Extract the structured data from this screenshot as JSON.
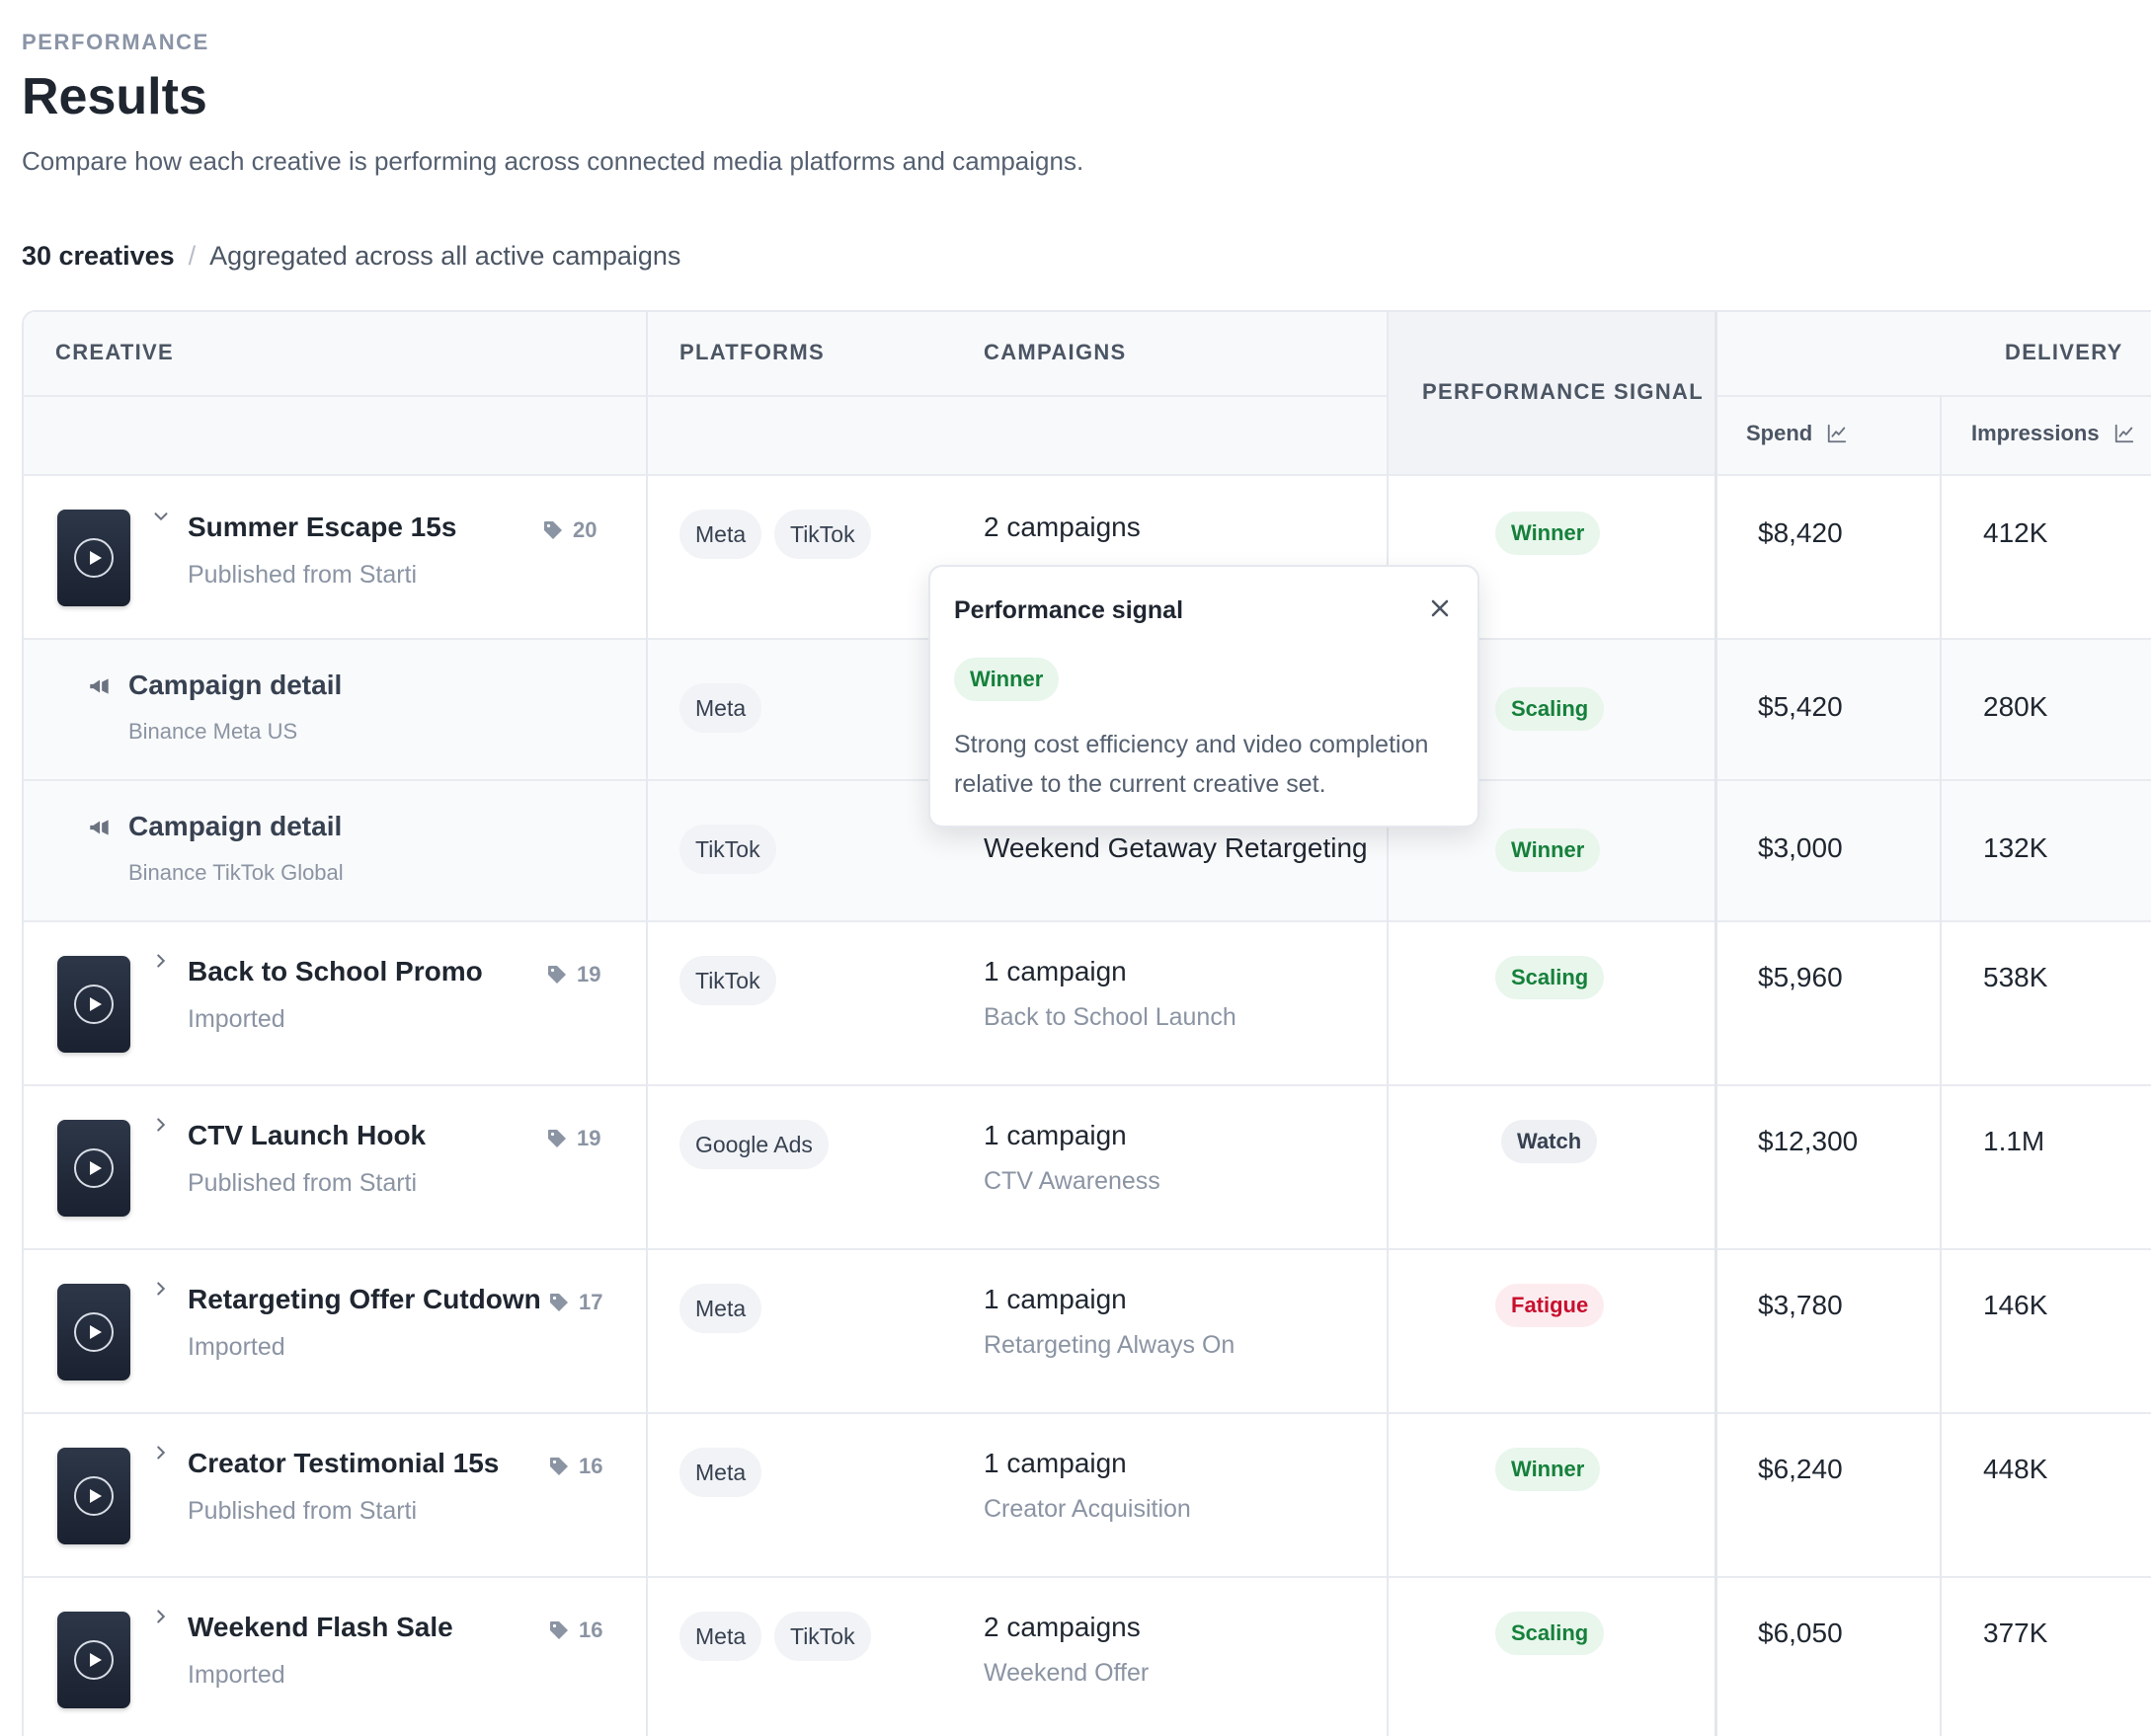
{
  "header": {
    "eyebrow": "PERFORMANCE",
    "title": "Results",
    "subtitle": "Compare how each creative is performing across connected media platforms and campaigns."
  },
  "summary": {
    "count": "30 creatives",
    "separator": "/",
    "description": "Aggregated across all active campaigns"
  },
  "columns": {
    "creative": "CREATIVE",
    "platforms": "PLATFORMS",
    "campaigns": "CAMPAIGNS",
    "signal": "PERFORMANCE SIGNAL",
    "delivery": "DELIVERY",
    "spend": "Spend",
    "impressions": "Impressions"
  },
  "rows": [
    {
      "name": "Summer Escape 15s",
      "source": "Published from Starti",
      "tags": "20",
      "platforms": [
        "Meta",
        "TikTok"
      ],
      "campaigns": "2 campaigns",
      "campaign_detail": "",
      "signal": "Winner",
      "spend": "$8,420",
      "impressions": "412K"
    },
    {
      "name": "Back to School Promo",
      "source": "Imported",
      "tags": "19",
      "platforms": [
        "TikTok"
      ],
      "campaigns": "1 campaign",
      "campaign_detail": "Back to School Launch",
      "signal": "Scaling",
      "spend": "$5,960",
      "impressions": "538K"
    },
    {
      "name": "CTV Launch Hook",
      "source": "Published from Starti",
      "tags": "19",
      "platforms": [
        "Google Ads"
      ],
      "campaigns": "1 campaign",
      "campaign_detail": "CTV Awareness",
      "signal": "Watch",
      "spend": "$12,300",
      "impressions": "1.1M"
    },
    {
      "name": "Retargeting Offer Cutdown",
      "source": "Imported",
      "tags": "17",
      "platforms": [
        "Meta"
      ],
      "campaigns": "1 campaign",
      "campaign_detail": "Retargeting Always On",
      "signal": "Fatigue",
      "spend": "$3,780",
      "impressions": "146K"
    },
    {
      "name": "Creator Testimonial 15s",
      "source": "Published from Starti",
      "tags": "16",
      "platforms": [
        "Meta"
      ],
      "campaigns": "1 campaign",
      "campaign_detail": "Creator Acquisition",
      "signal": "Winner",
      "spend": "$6,240",
      "impressions": "448K"
    },
    {
      "name": "Weekend Flash Sale",
      "source": "Imported",
      "tags": "16",
      "platforms": [
        "Meta",
        "TikTok"
      ],
      "campaigns": "2 campaigns",
      "campaign_detail": "Weekend Offer",
      "signal": "Scaling",
      "spend": "$6,050",
      "impressions": "377K"
    }
  ],
  "detail_rows": [
    {
      "label": "Campaign detail",
      "account": "Binance Meta US",
      "platform": "Meta",
      "campaign": "",
      "signal": "Scaling",
      "spend": "$5,420",
      "impressions": "280K"
    },
    {
      "label": "Campaign detail",
      "account": "Binance TikTok Global",
      "platform": "TikTok",
      "campaign": "Weekend Getaway Retargeting",
      "signal": "Winner",
      "spend": "$3,000",
      "impressions": "132K"
    }
  ],
  "popover": {
    "title": "Performance signal",
    "badge": "Winner",
    "text": "Strong cost efficiency and video completion relative to the current creative set."
  },
  "colors": {
    "winner": "#16803b",
    "scaling": "#16803b",
    "watch": "#374151",
    "fatigue": "#c8102e"
  }
}
